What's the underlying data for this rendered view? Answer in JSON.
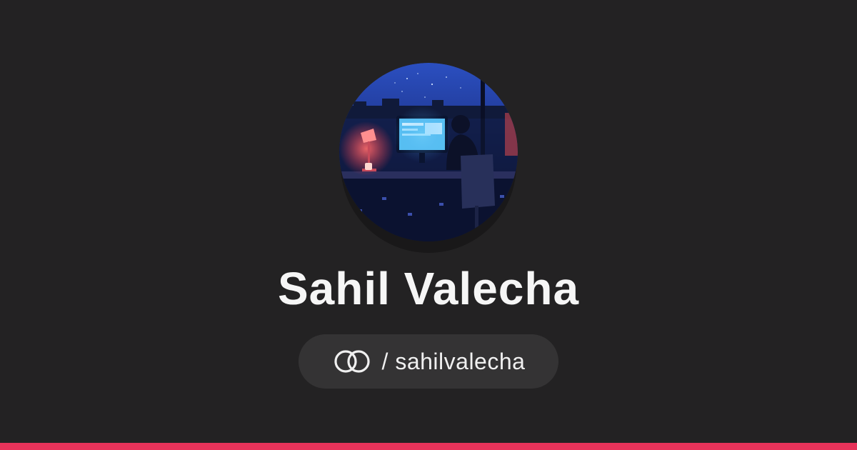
{
  "profile": {
    "display_name": "Sahil Valecha",
    "handle_text": "/ sahilvalecha"
  },
  "icons": {
    "link_icon": "linked-rings-icon"
  },
  "colors": {
    "background": "#232223",
    "pill": "#343334",
    "text": "#f6f6f6",
    "accent": "#e7335a"
  }
}
